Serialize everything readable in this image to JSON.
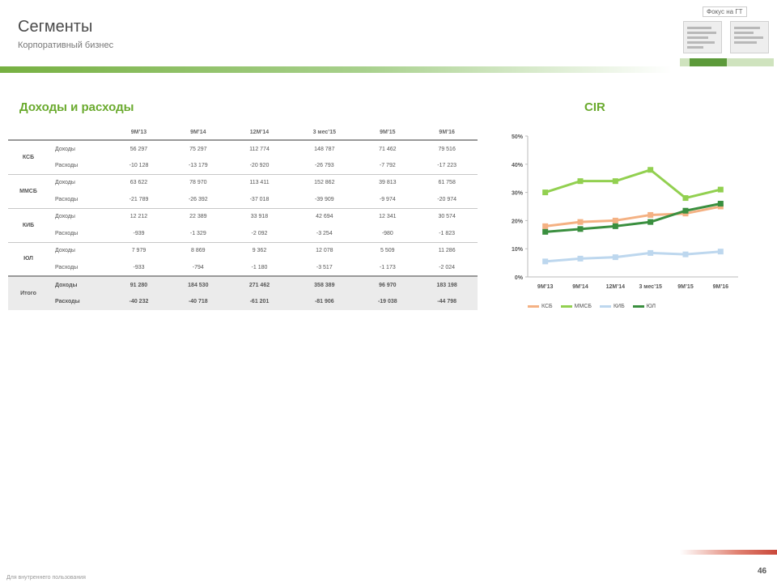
{
  "header": {
    "title": "Сегменты",
    "subtitle": "Корпоративный бизнес"
  },
  "nav": {
    "title": "Фокус на ГТ"
  },
  "section": {
    "table_title": "Доходы и расходы",
    "chart_title": "CIR"
  },
  "table": {
    "columns": [
      "",
      "",
      "9М’13",
      "9М’14",
      "12М’14",
      "3 мес’15",
      "9М’15",
      "9М’16"
    ],
    "groups": [
      {
        "segment": "КСБ",
        "rows": [
          {
            "type": "Доходы",
            "values": [
              "56 297",
              "75 297",
              "112 774",
              "148 787",
              "71 462",
              "79 516"
            ]
          },
          {
            "type": "Расходы",
            "values": [
              "-10 128",
              "-13 179",
              "-20 920",
              "-26 793",
              "-7 792",
              "-17 223"
            ]
          }
        ]
      },
      {
        "segment": "ММСБ",
        "rows": [
          {
            "type": "Доходы",
            "values": [
              "63 622",
              "78 970",
              "113 411",
              "152 862",
              "39 813",
              "61 758"
            ]
          },
          {
            "type": "Расходы",
            "values": [
              "-21 789",
              "-26 392",
              "-37 018",
              "-39 909",
              "-9 974",
              "-20 974"
            ]
          }
        ]
      },
      {
        "segment": "КИБ",
        "rows": [
          {
            "type": "Доходы",
            "values": [
              "12 212",
              "22 389",
              "33 918",
              "42 694",
              "12 341",
              "30 574"
            ]
          },
          {
            "type": "Расходы",
            "values": [
              "-939",
              "-1 329",
              "-2 092",
              "-3 254",
              "-980",
              "-1 823"
            ]
          }
        ]
      },
      {
        "segment": "ЮЛ",
        "rows": [
          {
            "type": "Доходы",
            "values": [
              "7 979",
              "8 869",
              "9 362",
              "12 078",
              "5 509",
              "11 286"
            ]
          },
          {
            "type": "Расходы",
            "values": [
              "-933",
              "-794",
              "-1 180",
              "-3 517",
              "-1 173",
              "-2 024"
            ]
          }
        ]
      }
    ],
    "total": {
      "segment": "Итого",
      "rows": [
        {
          "type": "Доходы",
          "values": [
            "91 280",
            "184 530",
            "271 462",
            "358 389",
            "96 970",
            "183 198"
          ]
        },
        {
          "type": "Расходы",
          "values": [
            "-40 232",
            "-40 718",
            "-61 201",
            "-81 906",
            "-19 038",
            "-44 798"
          ]
        }
      ]
    }
  },
  "chart_data": {
    "type": "line",
    "title": "CIR",
    "x": [
      "9М’13",
      "9М’14",
      "12М’14",
      "3 мес’15",
      "9М’15",
      "9М’16"
    ],
    "ylim": [
      0,
      50
    ],
    "yticks": [
      "0%",
      "10%",
      "20%",
      "30%",
      "40%",
      "50%"
    ],
    "series": [
      {
        "name": "КСБ",
        "color": "#f4b183",
        "values": [
          18,
          19.5,
          20,
          22,
          22.5,
          25
        ]
      },
      {
        "name": "ММСБ",
        "color": "#92d050",
        "values": [
          30,
          34,
          34,
          38,
          28,
          31
        ]
      },
      {
        "name": "КИБ",
        "color": "#bdd7ee",
        "values": [
          5.5,
          6.5,
          7,
          8.5,
          8,
          9
        ]
      },
      {
        "name": "ЮЛ",
        "color": "#3a8f3f",
        "values": [
          16,
          17,
          18,
          19.5,
          23.5,
          26
        ]
      }
    ],
    "legend_position": "bottom",
    "grid": false
  },
  "footer": {
    "text": "Для внутреннего пользования",
    "page": "46"
  }
}
